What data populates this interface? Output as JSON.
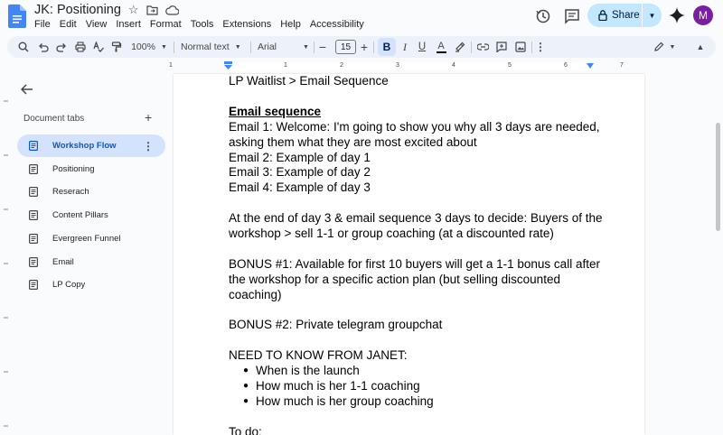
{
  "titlebar": {
    "doc_title": "JK: Positioning",
    "menu": [
      "File",
      "Edit",
      "View",
      "Insert",
      "Format",
      "Tools",
      "Extensions",
      "Help",
      "Accessibility"
    ],
    "share_label": "Share",
    "avatar_letter": "M"
  },
  "toolbar": {
    "zoom": "100%",
    "style": "Normal text",
    "font": "Arial",
    "font_size": "15",
    "bold_label": "B",
    "italic_label": "I",
    "underline_label": "U",
    "text_color_label": "A"
  },
  "ruler": {
    "numbers": [
      "1",
      "1",
      "2",
      "3",
      "4",
      "5",
      "6",
      "7"
    ]
  },
  "sidebar": {
    "header": "Document tabs",
    "tabs": [
      {
        "label": "Workshop Flow",
        "active": true
      },
      {
        "label": "Positioning"
      },
      {
        "label": "Reserach"
      },
      {
        "label": "Content Pillars"
      },
      {
        "label": "Evergreen Funnel"
      },
      {
        "label": "Email"
      },
      {
        "label": "LP Copy"
      }
    ]
  },
  "document": {
    "lines": [
      {
        "text": "LP Waitlist > Email Sequence"
      },
      {
        "text": ""
      },
      {
        "text": "Email sequence",
        "style": "h"
      },
      {
        "text": "Email 1: Welcome: I'm going to show you why all 3 days are needed, asking them what they are most excited about"
      },
      {
        "text": "Email 2: Example of day 1"
      },
      {
        "text": "Email 3: Example of day 2"
      },
      {
        "text": "Email 4: Example of day 3"
      },
      {
        "text": ""
      },
      {
        "text": "At the end of day 3 & email sequence 3 days to decide: Buyers of the workshop > sell 1-1 or group coaching (at a discounted rate)"
      },
      {
        "text": ""
      },
      {
        "text": "BONUS #1: Available for first 10 buyers will get a 1-1 bonus call after the workshop for a specific action plan (but selling discounted coaching)"
      },
      {
        "text": ""
      },
      {
        "text": "BONUS #2: Private telegram groupchat"
      },
      {
        "text": ""
      },
      {
        "text": "NEED TO KNOW FROM JANET:"
      }
    ],
    "bullets": [
      "When is the launch",
      "How much is her 1-1 coaching",
      "How much is her group coaching"
    ],
    "after": [
      {
        "text": ""
      },
      {
        "text": "To do:"
      }
    ]
  }
}
